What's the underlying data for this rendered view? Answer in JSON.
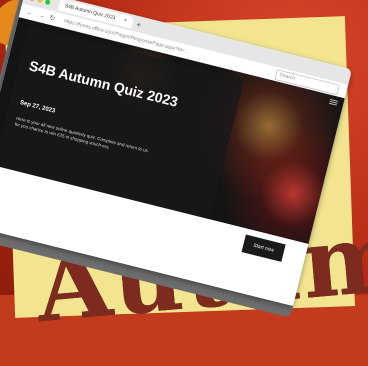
{
  "browser": {
    "tab_title": "S4B Autumn Quiz 2023",
    "address": "https://forms.office.com/Pages/ResponsePage.aspx?id=...",
    "search_placeholder": "Search"
  },
  "quiz": {
    "title": "S4B Autumn Quiz 2023",
    "date": "Sep 27, 2023",
    "description": "Here is your all new online quarterly quiz. Complete and return to us for you chance to win £25 in shopping vouch-ers.",
    "start_label": "Start now"
  },
  "artwork": {
    "headline": "Autumn"
  },
  "colors": {
    "background_red": "#c33b1d",
    "panel_yellow": "#f3e58f",
    "headline_brown": "#7e2b1f"
  }
}
